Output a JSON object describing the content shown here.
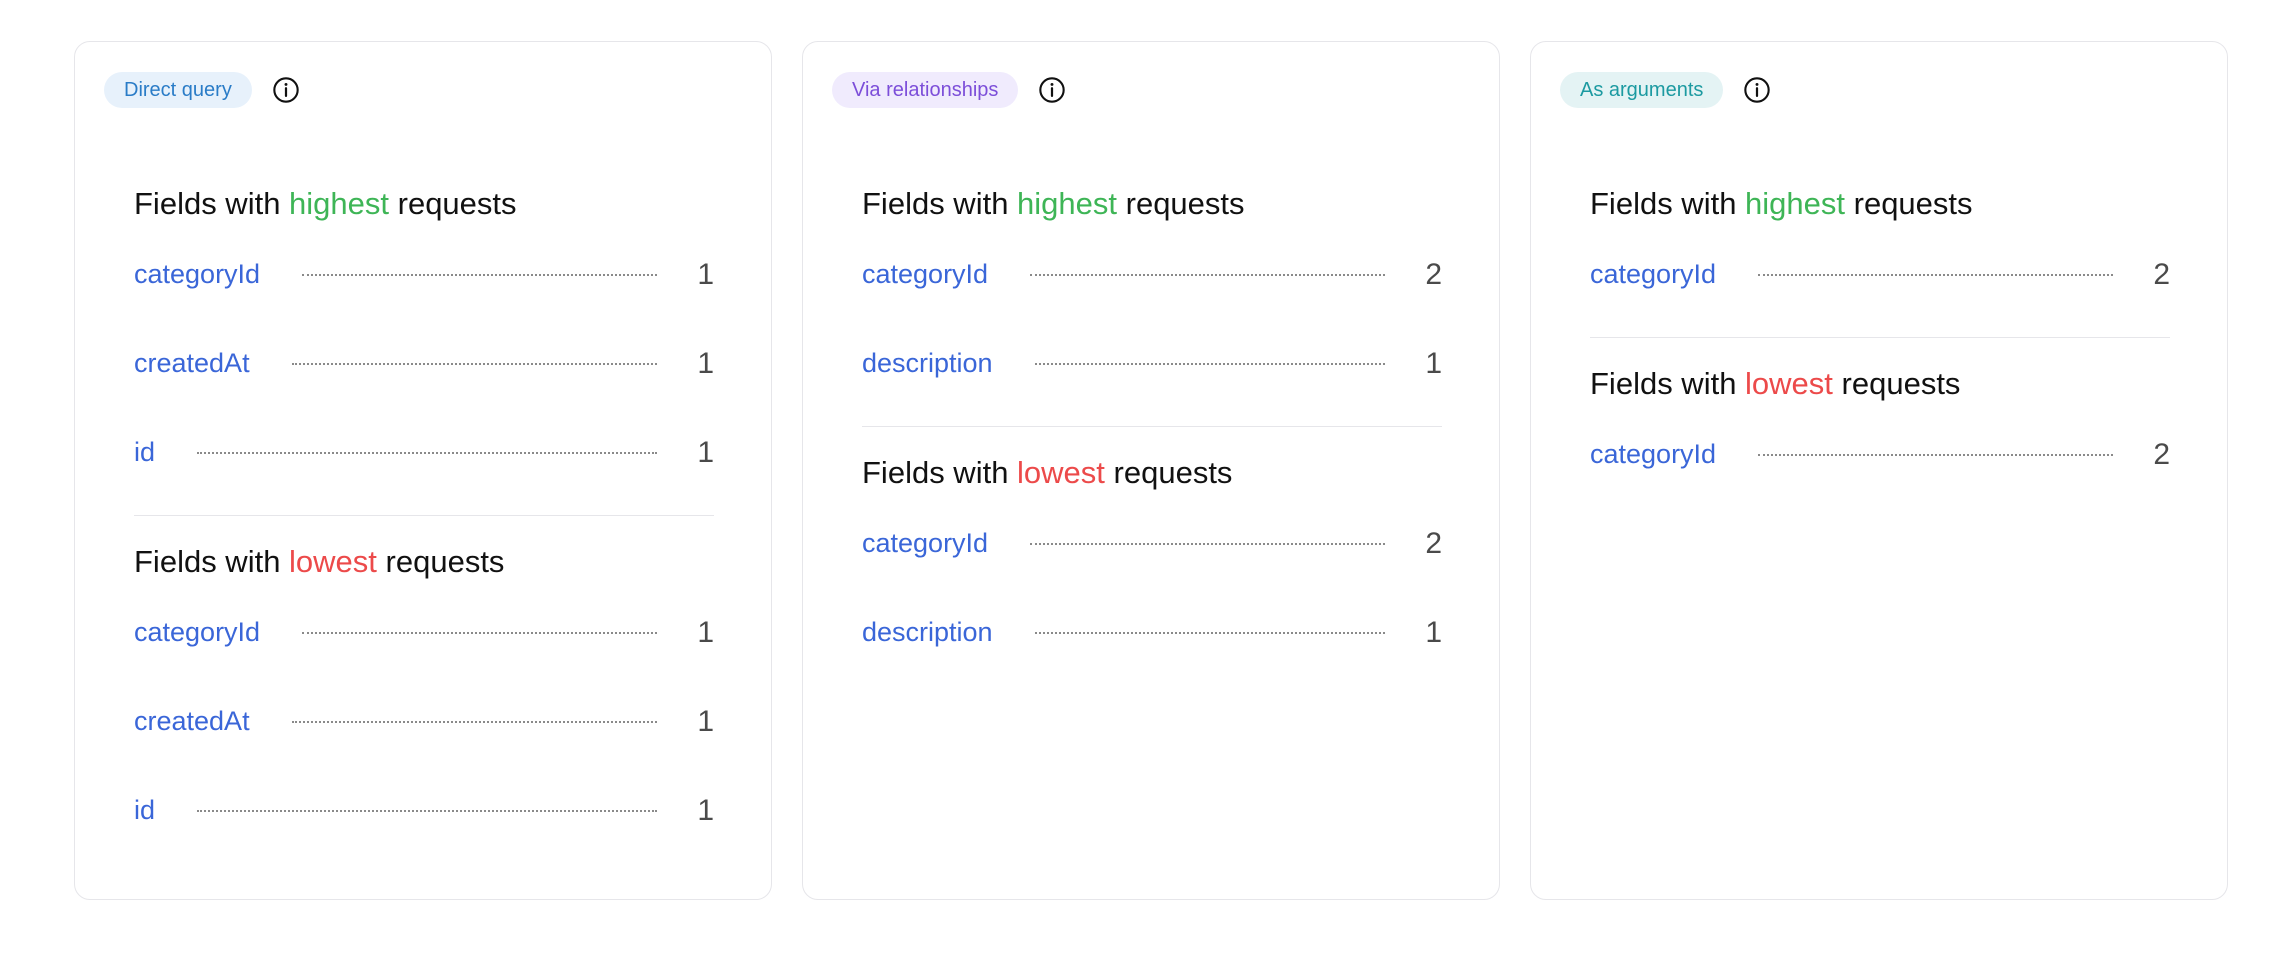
{
  "cards": [
    {
      "badge": "Direct query",
      "highest": {
        "prefix": "Fields with ",
        "emphasis": "highest",
        "suffix": " requests",
        "rows": [
          {
            "field": "categoryId",
            "count": "1"
          },
          {
            "field": "createdAt",
            "count": "1"
          },
          {
            "field": "id",
            "count": "1"
          }
        ]
      },
      "lowest": {
        "prefix": "Fields with ",
        "emphasis": "lowest",
        "suffix": " requests",
        "rows": [
          {
            "field": "categoryId",
            "count": "1"
          },
          {
            "field": "createdAt",
            "count": "1"
          },
          {
            "field": "id",
            "count": "1"
          }
        ]
      }
    },
    {
      "badge": "Via relationships",
      "highest": {
        "prefix": "Fields with ",
        "emphasis": "highest",
        "suffix": " requests",
        "rows": [
          {
            "field": "categoryId",
            "count": "2"
          },
          {
            "field": "description",
            "count": "1"
          }
        ]
      },
      "lowest": {
        "prefix": "Fields with ",
        "emphasis": "lowest",
        "suffix": " requests",
        "rows": [
          {
            "field": "categoryId",
            "count": "2"
          },
          {
            "field": "description",
            "count": "1"
          }
        ]
      }
    },
    {
      "badge": "As arguments",
      "highest": {
        "prefix": "Fields with ",
        "emphasis": "highest",
        "suffix": " requests",
        "rows": [
          {
            "field": "categoryId",
            "count": "2"
          }
        ]
      },
      "lowest": {
        "prefix": "Fields with ",
        "emphasis": "lowest",
        "suffix": " requests",
        "rows": [
          {
            "field": "categoryId",
            "count": "2"
          }
        ]
      }
    }
  ],
  "colors": {
    "highest": "#3eb556",
    "lowest": "#ec4a4a",
    "link": "#3a66d8",
    "badge_blue": "#2a7cc7",
    "badge_purple": "#7c4ed9",
    "badge_teal": "#1c9aa1"
  },
  "icons": {
    "info": "info-circle-icon"
  }
}
